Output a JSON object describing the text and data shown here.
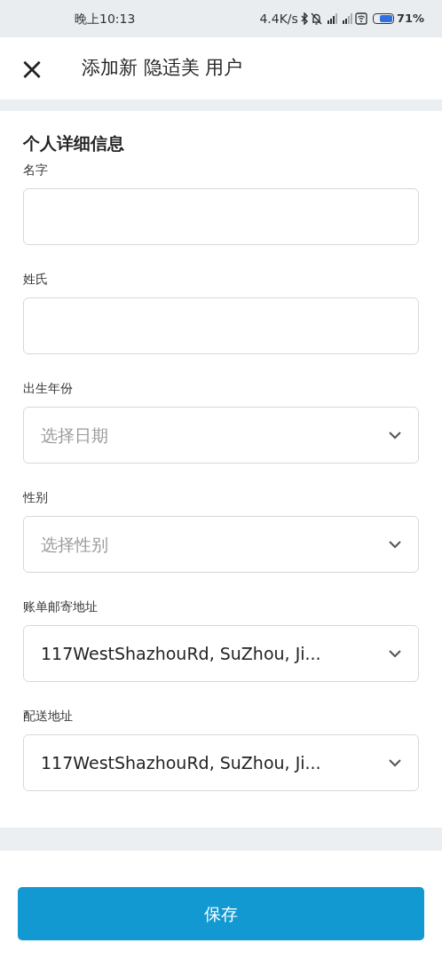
{
  "status_bar": {
    "time": "晚上10:13",
    "network_speed": "4.4K/s",
    "battery": "71%"
  },
  "header": {
    "close_icon": "×",
    "title": "添加新 隐适美 用户"
  },
  "section": {
    "title": "个人详细信息"
  },
  "fields": [
    {
      "kind": "text",
      "label": "名字"
    },
    {
      "kind": "text",
      "label": "姓氏"
    },
    {
      "kind": "select",
      "label": "出生年份",
      "placeholder": "选择日期"
    },
    {
      "kind": "select",
      "label": "性别",
      "placeholder": "选择性别"
    },
    {
      "kind": "select",
      "label": "账单邮寄地址",
      "value": "117WestShazhouRd, SuZhou, Ji..."
    },
    {
      "kind": "select",
      "label": "配送地址",
      "value": "117WestShazhouRd, SuZhou, Ji..."
    }
  ],
  "save_button": "保存"
}
